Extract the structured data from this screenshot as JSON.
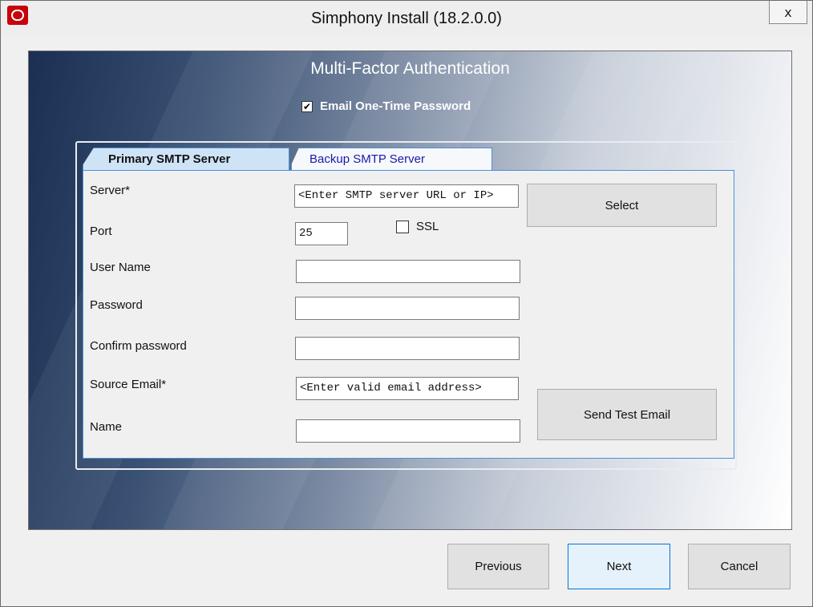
{
  "window": {
    "title": "Simphony Install (18.2.0.0)",
    "close_label": "x"
  },
  "header": {
    "heading": "Multi-Factor Authentication",
    "email_otp": {
      "label": "Email One-Time Password",
      "checked": true,
      "mark": "✔"
    }
  },
  "tabs": [
    {
      "label": "Primary SMTP Server",
      "selected": true
    },
    {
      "label": "Backup SMTP Server",
      "selected": false
    }
  ],
  "form": {
    "server_label": "Server*",
    "server_value": "<Enter SMTP server URL or IP>",
    "port_label": "Port",
    "port_value": "25",
    "ssl_label": "SSL",
    "ssl_checked": false,
    "username_label": "User Name",
    "username_value": "",
    "password_label": "Password",
    "password_value": "",
    "confirm_label": "Confirm password",
    "confirm_value": "",
    "source_email_label": "Source Email*",
    "source_email_value": "<Enter valid email address>",
    "name_label": "Name",
    "name_value": "",
    "select_button": "Select",
    "send_test_button": "Send Test Email"
  },
  "footer": {
    "previous": "Previous",
    "next": "Next",
    "cancel": "Cancel"
  },
  "colors": {
    "tab_border": "#4a90d9",
    "tab_selected_bg": "#cfe3f7",
    "app_icon": "#c8000a",
    "next_border": "#0078d7"
  }
}
